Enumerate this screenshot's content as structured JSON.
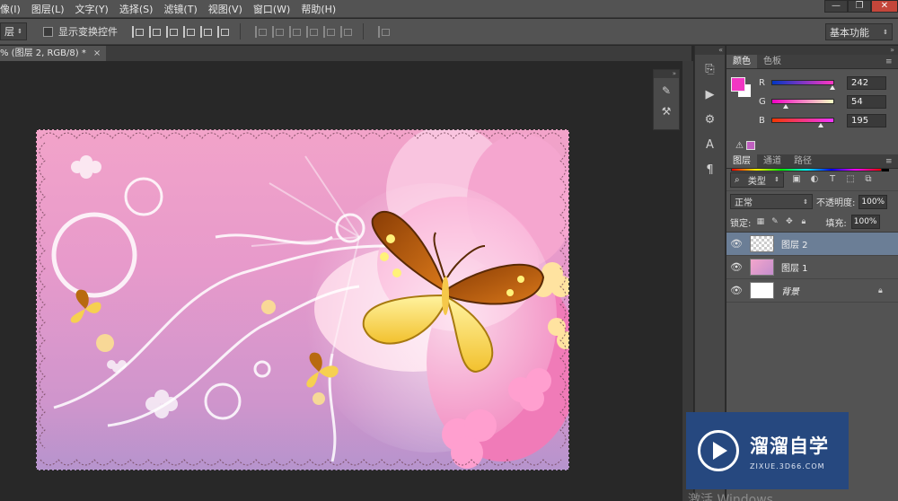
{
  "menu": [
    "像(I)",
    "图层(L)",
    "文字(Y)",
    "选择(S)",
    "滤镜(T)",
    "视图(V)",
    "窗口(W)",
    "帮助(H)"
  ],
  "window_controls": [
    "—",
    "❐",
    "✕"
  ],
  "options_bar": {
    "target_select": "层",
    "show_transform_label": "显示变换控件",
    "workspace": "基本功能"
  },
  "document_tab": {
    "title": "% (图层 2, RGB/8) *",
    "close": "×"
  },
  "color_panel": {
    "tabs": [
      "颜色",
      "色板"
    ],
    "foreground_color": "#f236c3",
    "background_color": "#ffffff",
    "channels": [
      {
        "label": "R",
        "value": "242"
      },
      {
        "label": "G",
        "value": "54"
      },
      {
        "label": "B",
        "value": "195"
      }
    ]
  },
  "layers_panel": {
    "tabs": [
      "图层",
      "通道",
      "路径"
    ],
    "filter_kind": "类型",
    "blend_mode": "正常",
    "opacity_label": "不透明度:",
    "opacity_value": "100%",
    "lock_label": "锁定:",
    "fill_label": "填充:",
    "fill_value": "100%",
    "layers": [
      {
        "name": "图层 2",
        "selected": true
      },
      {
        "name": "图层 1",
        "selected": false
      },
      {
        "name": "背景",
        "selected": false,
        "locked": true
      }
    ]
  },
  "watermark": {
    "title": "溜溜自学",
    "subtitle": "ZIXUE.3D66.COM"
  },
  "activate_text": "激活 Windows"
}
